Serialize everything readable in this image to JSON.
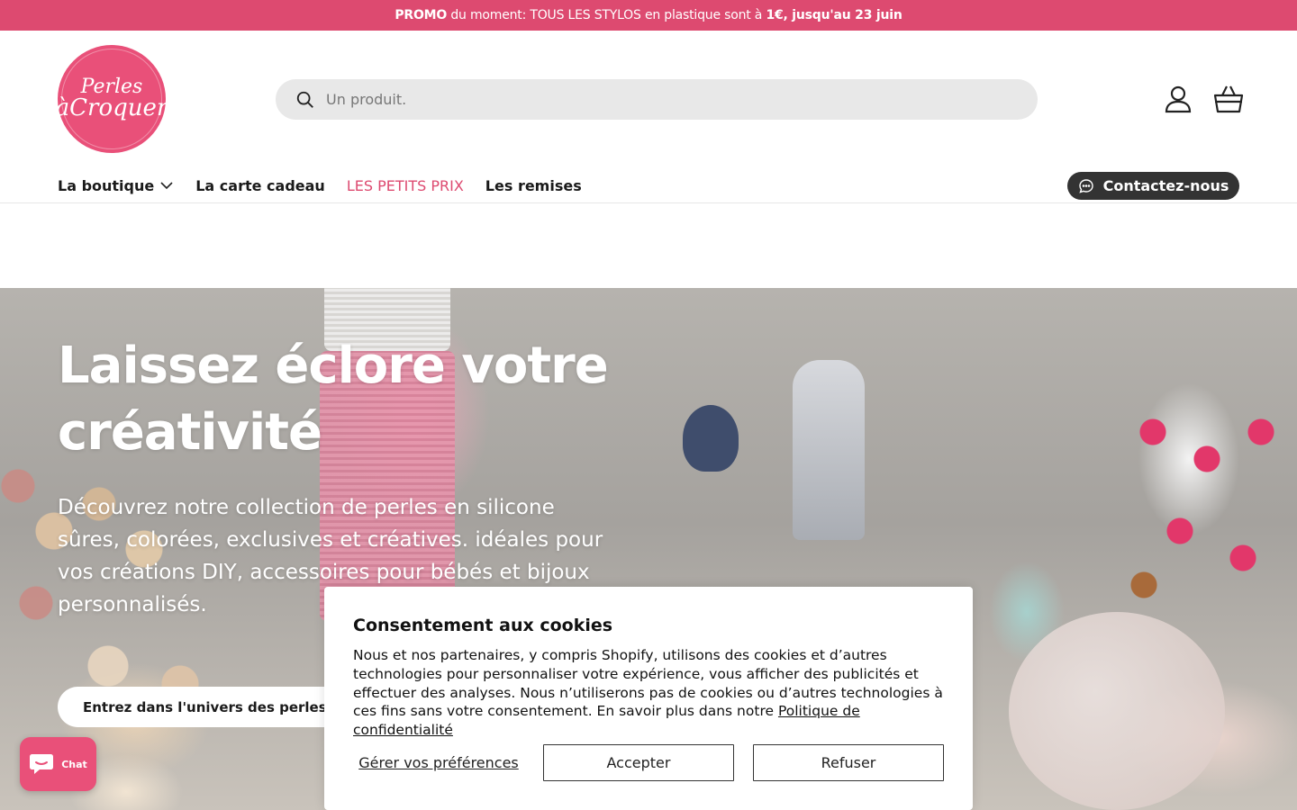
{
  "promo": {
    "bold1": "PROMO",
    "text1": " du moment: TOUS LES STYLOS en plastique sont à ",
    "bold2": "1€, jusqu'au 23 juin"
  },
  "logo": {
    "line1": "Perles",
    "line2": "àCroquer"
  },
  "search": {
    "placeholder": "Un produit."
  },
  "nav": {
    "items": [
      {
        "label": "La boutique",
        "has_dropdown": true
      },
      {
        "label": "La carte cadeau"
      },
      {
        "label": "LES PETITS PRIX",
        "color": "#dd4a70"
      },
      {
        "label": "Les remises"
      }
    ],
    "contact_label": "Contactez-nous"
  },
  "hero": {
    "title": "Laissez éclore votre créativité",
    "subtitle": "Découvrez notre collection de perles en silicone sûres, colorées, exclusives et créatives. idéales pour vos créations DIY, accessoires pour bébés et bijoux personnalisés.",
    "button_label": "Entrez dans l'univers des perles en silicone"
  },
  "cookie": {
    "title": "Consentement aux cookies",
    "body": "Nous et nos partenaires, y compris Shopify, utilisons des cookies et d’autres technologies pour personnaliser votre expérience, vous afficher des publicités et effectuer des analyses. Nous n’utiliserons pas de cookies ou d’autres technologies à ces fins sans votre consentement. En savoir plus dans notre ",
    "policy_link": "Politique de confidentialité",
    "preferences_label": "Gérer vos préférences",
    "accept_label": "Accepter",
    "refuse_label": "Refuser"
  },
  "chat": {
    "label": "Chat"
  },
  "colors": {
    "brand_pink": "#dd4a70",
    "logo_pink": "#e95079",
    "dark": "#333333"
  }
}
